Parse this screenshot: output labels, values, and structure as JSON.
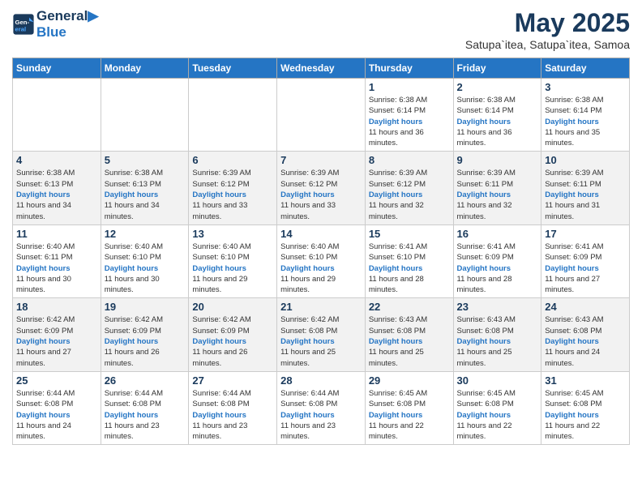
{
  "header": {
    "logo_line1": "General",
    "logo_line2": "Blue",
    "month_title": "May 2025",
    "location": "Satupa`itea, Satupa`itea, Samoa"
  },
  "days_of_week": [
    "Sunday",
    "Monday",
    "Tuesday",
    "Wednesday",
    "Thursday",
    "Friday",
    "Saturday"
  ],
  "weeks": [
    [
      {
        "day": "",
        "info": ""
      },
      {
        "day": "",
        "info": ""
      },
      {
        "day": "",
        "info": ""
      },
      {
        "day": "",
        "info": ""
      },
      {
        "day": "1",
        "sunrise": "6:38 AM",
        "sunset": "6:14 PM",
        "daylight": "11 hours and 36 minutes."
      },
      {
        "day": "2",
        "sunrise": "6:38 AM",
        "sunset": "6:14 PM",
        "daylight": "11 hours and 36 minutes."
      },
      {
        "day": "3",
        "sunrise": "6:38 AM",
        "sunset": "6:14 PM",
        "daylight": "11 hours and 35 minutes."
      }
    ],
    [
      {
        "day": "4",
        "sunrise": "6:38 AM",
        "sunset": "6:13 PM",
        "daylight": "11 hours and 34 minutes."
      },
      {
        "day": "5",
        "sunrise": "6:38 AM",
        "sunset": "6:13 PM",
        "daylight": "11 hours and 34 minutes."
      },
      {
        "day": "6",
        "sunrise": "6:39 AM",
        "sunset": "6:12 PM",
        "daylight": "11 hours and 33 minutes."
      },
      {
        "day": "7",
        "sunrise": "6:39 AM",
        "sunset": "6:12 PM",
        "daylight": "11 hours and 33 minutes."
      },
      {
        "day": "8",
        "sunrise": "6:39 AM",
        "sunset": "6:12 PM",
        "daylight": "11 hours and 32 minutes."
      },
      {
        "day": "9",
        "sunrise": "6:39 AM",
        "sunset": "6:11 PM",
        "daylight": "11 hours and 32 minutes."
      },
      {
        "day": "10",
        "sunrise": "6:39 AM",
        "sunset": "6:11 PM",
        "daylight": "11 hours and 31 minutes."
      }
    ],
    [
      {
        "day": "11",
        "sunrise": "6:40 AM",
        "sunset": "6:11 PM",
        "daylight": "11 hours and 30 minutes."
      },
      {
        "day": "12",
        "sunrise": "6:40 AM",
        "sunset": "6:10 PM",
        "daylight": "11 hours and 30 minutes."
      },
      {
        "day": "13",
        "sunrise": "6:40 AM",
        "sunset": "6:10 PM",
        "daylight": "11 hours and 29 minutes."
      },
      {
        "day": "14",
        "sunrise": "6:40 AM",
        "sunset": "6:10 PM",
        "daylight": "11 hours and 29 minutes."
      },
      {
        "day": "15",
        "sunrise": "6:41 AM",
        "sunset": "6:10 PM",
        "daylight": "11 hours and 28 minutes."
      },
      {
        "day": "16",
        "sunrise": "6:41 AM",
        "sunset": "6:09 PM",
        "daylight": "11 hours and 28 minutes."
      },
      {
        "day": "17",
        "sunrise": "6:41 AM",
        "sunset": "6:09 PM",
        "daylight": "11 hours and 27 minutes."
      }
    ],
    [
      {
        "day": "18",
        "sunrise": "6:42 AM",
        "sunset": "6:09 PM",
        "daylight": "11 hours and 27 minutes."
      },
      {
        "day": "19",
        "sunrise": "6:42 AM",
        "sunset": "6:09 PM",
        "daylight": "11 hours and 26 minutes."
      },
      {
        "day": "20",
        "sunrise": "6:42 AM",
        "sunset": "6:09 PM",
        "daylight": "11 hours and 26 minutes."
      },
      {
        "day": "21",
        "sunrise": "6:42 AM",
        "sunset": "6:08 PM",
        "daylight": "11 hours and 25 minutes."
      },
      {
        "day": "22",
        "sunrise": "6:43 AM",
        "sunset": "6:08 PM",
        "daylight": "11 hours and 25 minutes."
      },
      {
        "day": "23",
        "sunrise": "6:43 AM",
        "sunset": "6:08 PM",
        "daylight": "11 hours and 25 minutes."
      },
      {
        "day": "24",
        "sunrise": "6:43 AM",
        "sunset": "6:08 PM",
        "daylight": "11 hours and 24 minutes."
      }
    ],
    [
      {
        "day": "25",
        "sunrise": "6:44 AM",
        "sunset": "6:08 PM",
        "daylight": "11 hours and 24 minutes."
      },
      {
        "day": "26",
        "sunrise": "6:44 AM",
        "sunset": "6:08 PM",
        "daylight": "11 hours and 23 minutes."
      },
      {
        "day": "27",
        "sunrise": "6:44 AM",
        "sunset": "6:08 PM",
        "daylight": "11 hours and 23 minutes."
      },
      {
        "day": "28",
        "sunrise": "6:44 AM",
        "sunset": "6:08 PM",
        "daylight": "11 hours and 23 minutes."
      },
      {
        "day": "29",
        "sunrise": "6:45 AM",
        "sunset": "6:08 PM",
        "daylight": "11 hours and 22 minutes."
      },
      {
        "day": "30",
        "sunrise": "6:45 AM",
        "sunset": "6:08 PM",
        "daylight": "11 hours and 22 minutes."
      },
      {
        "day": "31",
        "sunrise": "6:45 AM",
        "sunset": "6:08 PM",
        "daylight": "11 hours and 22 minutes."
      }
    ]
  ],
  "labels": {
    "sunrise": "Sunrise:",
    "sunset": "Sunset:",
    "daylight": "Daylight:"
  }
}
